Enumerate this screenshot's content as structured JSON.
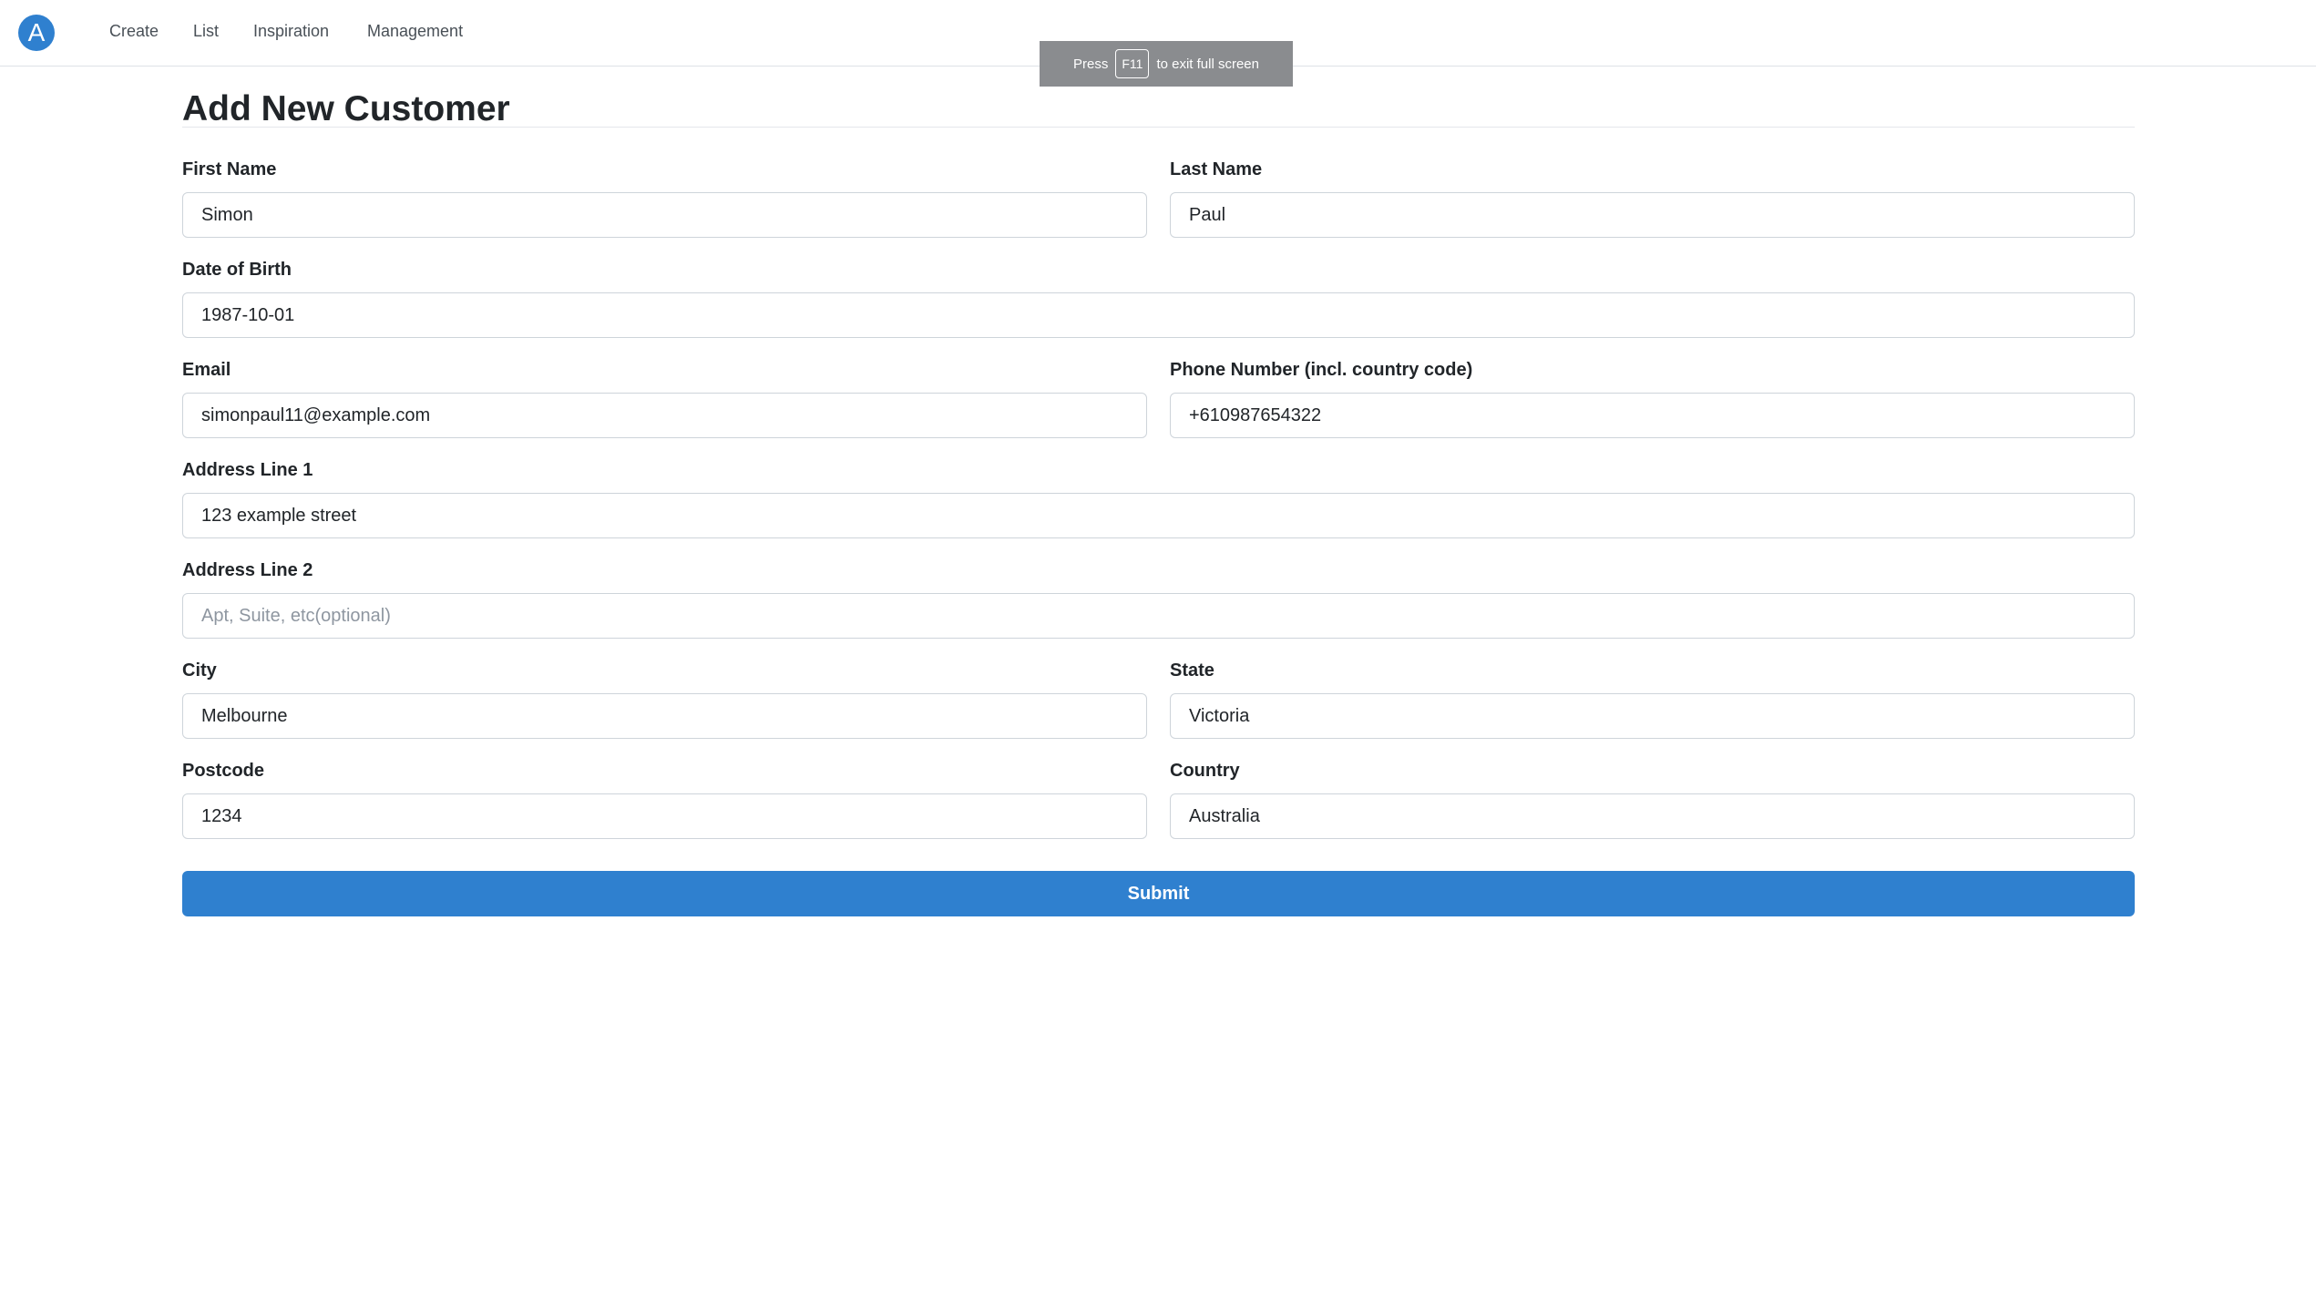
{
  "colors": {
    "accent": "#2f80cf",
    "border": "#ced4da",
    "hint_bg": "#8a8c8f"
  },
  "nav": {
    "logo_icon": "logo-a-icon",
    "logo_letter": "A",
    "items": [
      {
        "label": "Create"
      },
      {
        "label": "List"
      },
      {
        "label": "Inspiration"
      },
      {
        "label": "Management"
      }
    ]
  },
  "fullscreen_hint": {
    "press": "Press",
    "key": "F11",
    "rest": "to exit full screen"
  },
  "page": {
    "title": "Add New Customer"
  },
  "form": {
    "first_name": {
      "label": "First Name",
      "value": "Simon"
    },
    "last_name": {
      "label": "Last Name",
      "value": "Paul"
    },
    "dob": {
      "label": "Date of Birth",
      "value": "1987-10-01"
    },
    "email": {
      "label": "Email",
      "value": "simonpaul11@example.com"
    },
    "phone": {
      "label": "Phone Number (incl. country code)",
      "value": "+610987654322"
    },
    "address1": {
      "label": "Address Line 1",
      "value": "123 example street"
    },
    "address2": {
      "label": "Address Line 2",
      "value": "",
      "placeholder": "Apt, Suite, etc(optional)"
    },
    "city": {
      "label": "City",
      "value": "Melbourne"
    },
    "state": {
      "label": "State",
      "value": "Victoria"
    },
    "postcode": {
      "label": "Postcode",
      "value": "1234"
    },
    "country": {
      "label": "Country",
      "value": "Australia"
    },
    "submit_label": "Submit"
  }
}
